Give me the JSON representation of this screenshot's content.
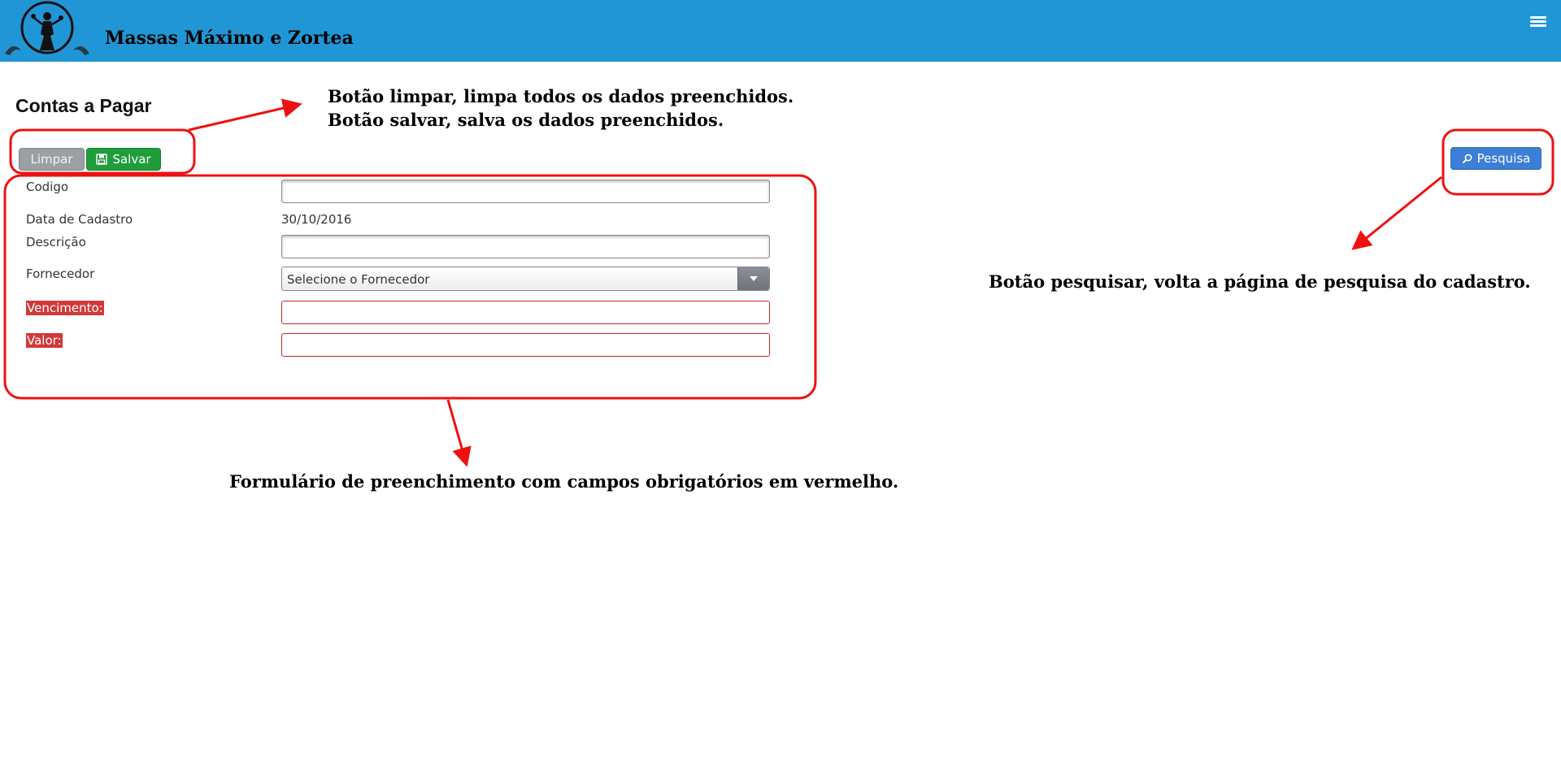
{
  "header": {
    "brand": "Massas Máximo e Zortea",
    "logo_icon": "woman-silhouette-logo-icon",
    "menu_icon": "hamburger-menu-icon",
    "bg_color": "#2196d6"
  },
  "page": {
    "title": "Contas a Pagar"
  },
  "toolbar": {
    "limpar_label": "Limpar",
    "salvar_label": "Salvar",
    "salvar_icon": "floppy-disk-icon",
    "pesquisa_label": "Pesquisa",
    "pesquisa_icon": "magnifier-icon"
  },
  "form": {
    "codigo_label": "Codigo",
    "codigo_value": "",
    "data_cadastro_label": "Data de Cadastro",
    "data_cadastro_value": "30/10/2016",
    "descricao_label": "Descrição",
    "descricao_value": "",
    "fornecedor_label": "Fornecedor",
    "fornecedor_selected": "Selecione o Fornecedor",
    "vencimento_label": "Vencimento:",
    "vencimento_value": "",
    "valor_label": "Valor:",
    "valor_value": "",
    "required_color": "#d0393b"
  },
  "annotations": {
    "buttons_line1": "Botão limpar, limpa todos os dados preenchidos.",
    "buttons_line2": "Botão salvar, salva os dados preenchidos.",
    "search": "Botão pesquisar, volta a página de pesquisa do cadastro.",
    "form": "Formulário de preenchimento com campos obrigatórios em vermelho.",
    "highlight_color": "#ee1111"
  }
}
